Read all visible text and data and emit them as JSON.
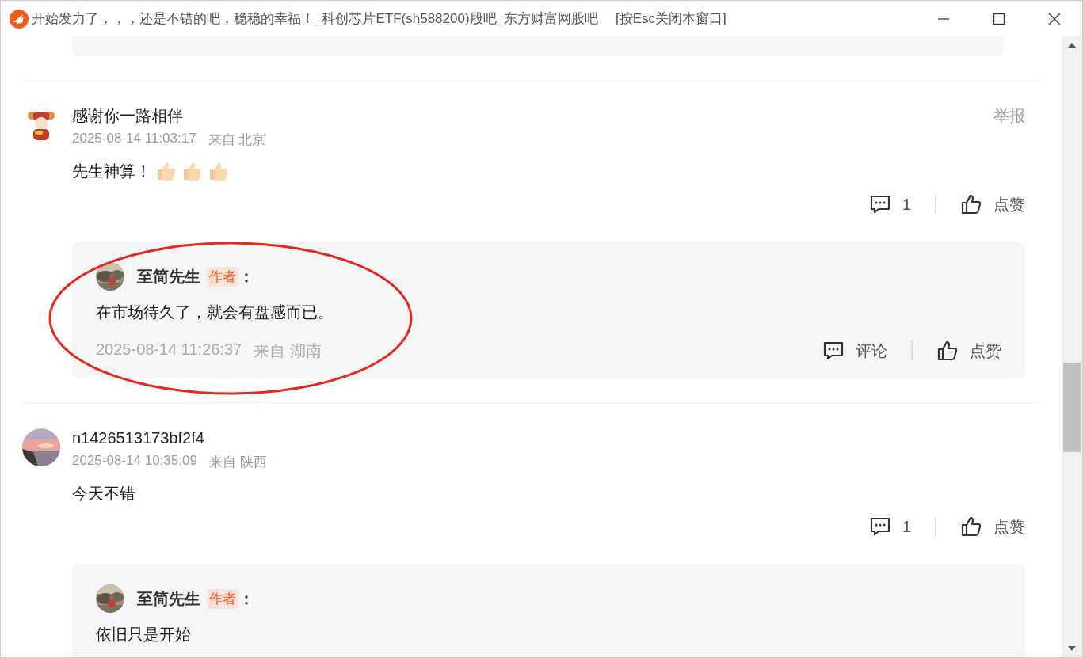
{
  "window": {
    "title": "开始发力了，，，还是不错的吧，稳稳的幸福！_科创芯片ETF(sh588200)股吧_东方财富网股吧",
    "hint": "[按Esc关闭本窗口]"
  },
  "comments": [
    {
      "user": "感谢你一路相伴",
      "time": "2025-08-14 11:03:17",
      "location": "来自 北京",
      "report": "举报",
      "text": "先生神算！",
      "emojis": [
        {
          "kind": "thumbs-up"
        },
        {
          "kind": "thumbs-up"
        },
        {
          "kind": "thumbs-up"
        }
      ],
      "comment_count": "1",
      "like_label": "点赞",
      "replies": [
        {
          "user": "至简先生",
          "badge": "作者",
          "colon": "：",
          "text": "在市场待久了，就会有盘感而已。",
          "time": "2025-08-14 11:26:37",
          "location": "来自 湖南",
          "comment_label": "评论",
          "like_label": "点赞",
          "circled": true
        }
      ]
    },
    {
      "user": "n1426513173bf2f4",
      "time": "2025-08-14 10:35:09",
      "location": "来自 陕西",
      "text": "今天不错",
      "comment_count": "1",
      "like_label": "点赞",
      "replies": [
        {
          "user": "至简先生",
          "badge": "作者",
          "colon": "：",
          "text": "依旧只是开始",
          "circled": false
        }
      ]
    }
  ]
}
